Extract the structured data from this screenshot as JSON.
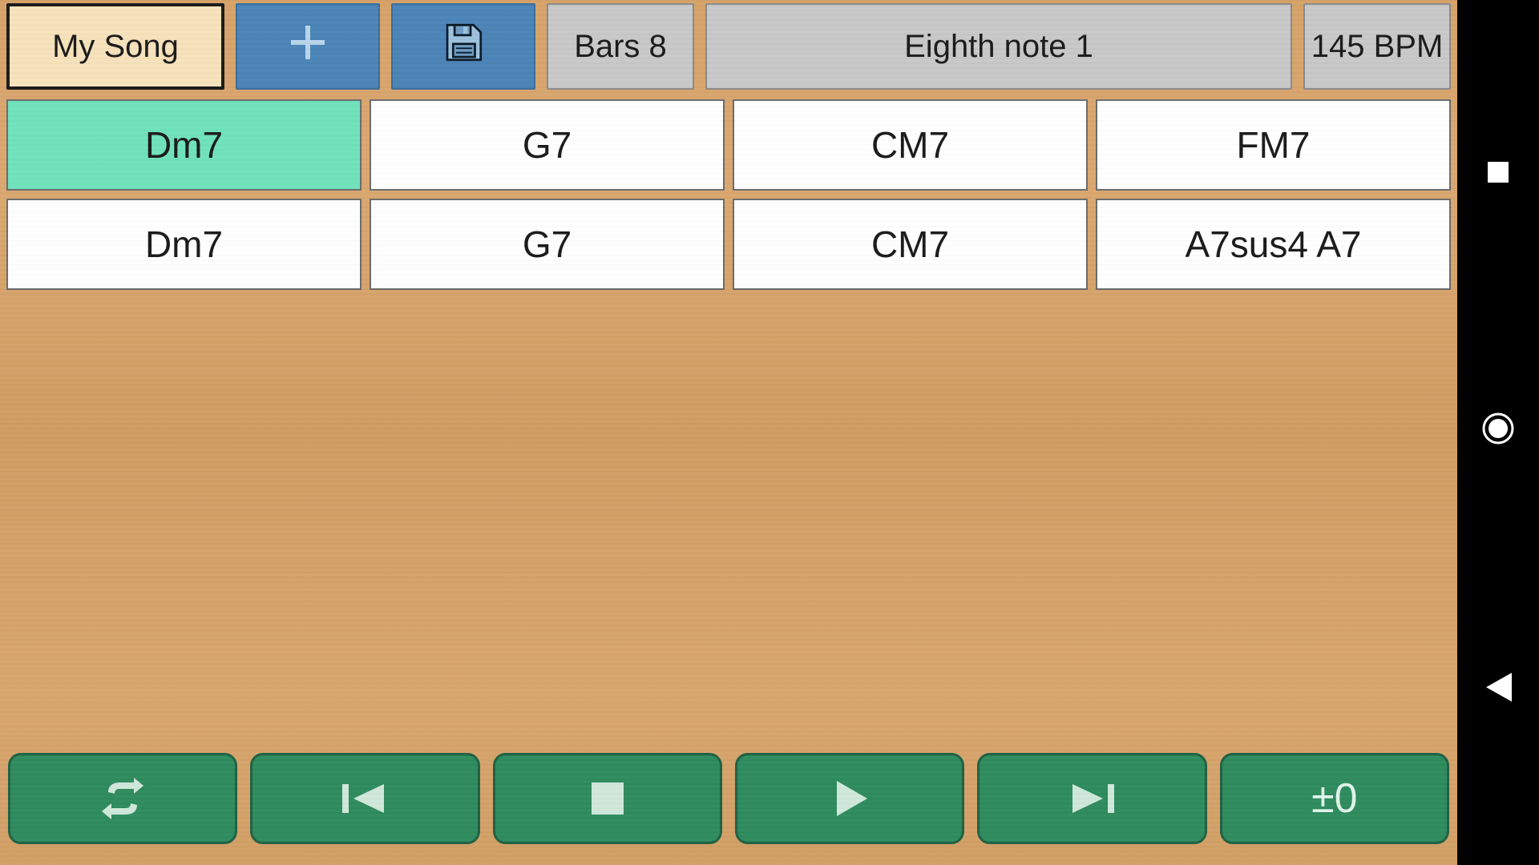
{
  "colors": {
    "song_title_bg": "#f6e2bb",
    "action_blue": "#4a84b7",
    "gray_btn": "#c8c8c8",
    "transport_green": "#2e8b5e",
    "active_cell": "#6fe2bb"
  },
  "toolbar": {
    "song_title": "My Song",
    "new_icon": "plus-icon",
    "save_icon": "floppy-icon",
    "bars_label": "Bars  8",
    "style_label": "Eighth note 1",
    "bpm_label": "145 BPM"
  },
  "chords": {
    "rows": [
      [
        "Dm7",
        "G7",
        "CM7",
        "FM7"
      ],
      [
        "Dm7",
        "G7",
        "CM7",
        "A7sus4  A7"
      ]
    ],
    "active_row": 0,
    "active_col": 0
  },
  "transport": {
    "loop_icon": "loop-icon",
    "prev_icon": "skip-previous-icon",
    "stop_icon": "stop-icon",
    "play_icon": "play-icon",
    "next_icon": "skip-next-icon",
    "transpose_label": "±0"
  },
  "system_nav": {
    "recents_icon": "square-icon",
    "home_icon": "circle-icon",
    "back_icon": "triangle-back-icon"
  }
}
